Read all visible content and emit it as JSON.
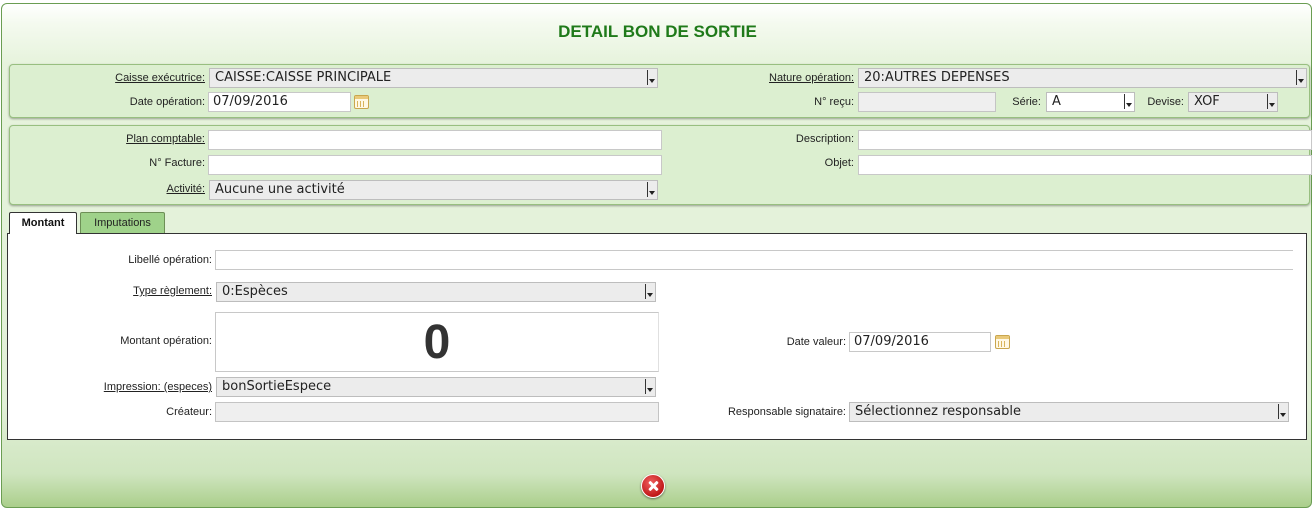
{
  "header": {
    "title": "DETAIL BON DE SORTIE"
  },
  "section1": {
    "caisse_label": "Caisse exécutrice:",
    "caisse_value": "CAISSE:CAISSE PRINCIPALE",
    "date_label": "Date opération:",
    "date_value": "07/09/2016",
    "nature_label": "Nature opération:",
    "nature_value": "20:AUTRES DEPENSES",
    "recu_label": "N° reçu:",
    "recu_value": "",
    "serie_label": "Série:",
    "serie_value": "A",
    "devise_label": "Devise:",
    "devise_value": "XOF"
  },
  "section2": {
    "plan_label": "Plan comptable:",
    "plan_value": "",
    "facture_label": "N° Facture:",
    "facture_value": "",
    "activite_label": "Activité:",
    "activite_value": "Aucune une activité",
    "description_label": "Description:",
    "description_value": "",
    "objet_label": "Objet:",
    "objet_value": ""
  },
  "tabs": [
    {
      "label": "Montant",
      "active": true
    },
    {
      "label": "Imputations",
      "active": false
    }
  ],
  "montant": {
    "libelle_label": "Libellé opération:",
    "libelle_value": "",
    "reglement_label": "Type règlement:",
    "reglement_value": "0:Espèces",
    "montant_label": "Montant opération:",
    "montant_value": "0",
    "date_valeur_label": "Date valeur:",
    "date_valeur_value": "07/09/2016",
    "impression_label": "Impression: (especes)",
    "impression_value": "bonSortieEspece",
    "createur_label": "Créateur:",
    "createur_value": "",
    "responsable_label": "Responsable signataire:",
    "responsable_value": "Sélectionnez responsable"
  },
  "colors": {
    "title": "#1f7a1a",
    "panel": "#dcefd0",
    "tab_inactive": "#9fd28a",
    "close": "#c01818"
  },
  "icons": {
    "calendar": "calendar-icon",
    "close": "close-icon"
  }
}
